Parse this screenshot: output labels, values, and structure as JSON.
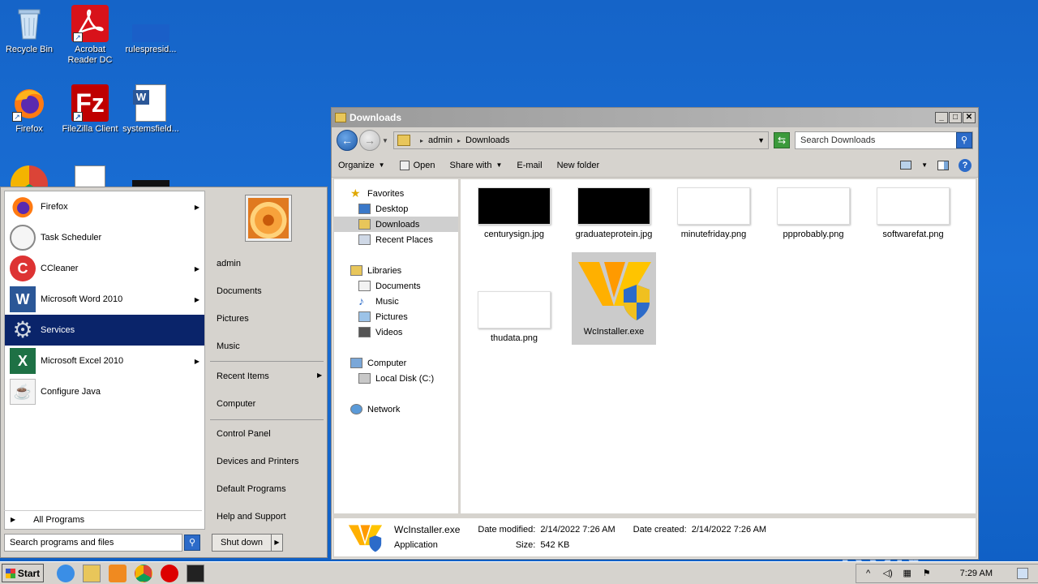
{
  "desktop": {
    "icons": [
      {
        "label": "Recycle Bin"
      },
      {
        "label": "Acrobat Reader DC"
      },
      {
        "label": "rulespresid..."
      },
      {
        "label": "Firefox"
      },
      {
        "label": "FileZilla Client"
      },
      {
        "label": "systemsfield..."
      }
    ],
    "watermark": "ANY ▷ RUN"
  },
  "explorer": {
    "title": "Downloads",
    "breadcrumb": [
      "admin",
      "Downloads"
    ],
    "search_placeholder": "Search Downloads",
    "toolbar": {
      "organize": "Organize",
      "open": "Open",
      "share_with": "Share with",
      "email": "E-mail",
      "new_folder": "New folder"
    },
    "nav": {
      "favorites": "Favorites",
      "desktop": "Desktop",
      "downloads": "Downloads",
      "recent_places": "Recent Places",
      "libraries": "Libraries",
      "documents": "Documents",
      "music": "Music",
      "pictures": "Pictures",
      "videos": "Videos",
      "computer": "Computer",
      "local_disk": "Local Disk (C:)",
      "network": "Network"
    },
    "files": [
      {
        "name": "centurysign.jpg"
      },
      {
        "name": "graduateprotein.jpg"
      },
      {
        "name": "minutefriday.png"
      },
      {
        "name": "ppprobably.png"
      },
      {
        "name": "softwarefat.png"
      },
      {
        "name": "thudata.png"
      },
      {
        "name": "WcInstaller.exe"
      }
    ],
    "status": {
      "name": "WcInstaller.exe",
      "type": "Application",
      "date_modified_label": "Date modified:",
      "date_modified": "2/14/2022 7:26 AM",
      "size_label": "Size:",
      "size": "542 KB",
      "date_created_label": "Date created:",
      "date_created": "2/14/2022 7:26 AM"
    }
  },
  "start_menu": {
    "programs": [
      {
        "label": "Firefox"
      },
      {
        "label": "Task Scheduler"
      },
      {
        "label": "CCleaner"
      },
      {
        "label": "Microsoft Word 2010"
      },
      {
        "label": "Services"
      },
      {
        "label": "Microsoft Excel 2010"
      },
      {
        "label": "Configure Java"
      }
    ],
    "all_programs": "All Programs",
    "search_placeholder": "Search programs and files",
    "shutdown": "Shut down",
    "right_links": {
      "user": "admin",
      "documents": "Documents",
      "pictures": "Pictures",
      "music": "Music",
      "recent_items": "Recent Items",
      "computer": "Computer",
      "control_panel": "Control Panel",
      "devices_printers": "Devices and Printers",
      "default_programs": "Default Programs",
      "help_support": "Help and Support"
    }
  },
  "taskbar": {
    "start": "Start",
    "clock": "7:29 AM"
  }
}
